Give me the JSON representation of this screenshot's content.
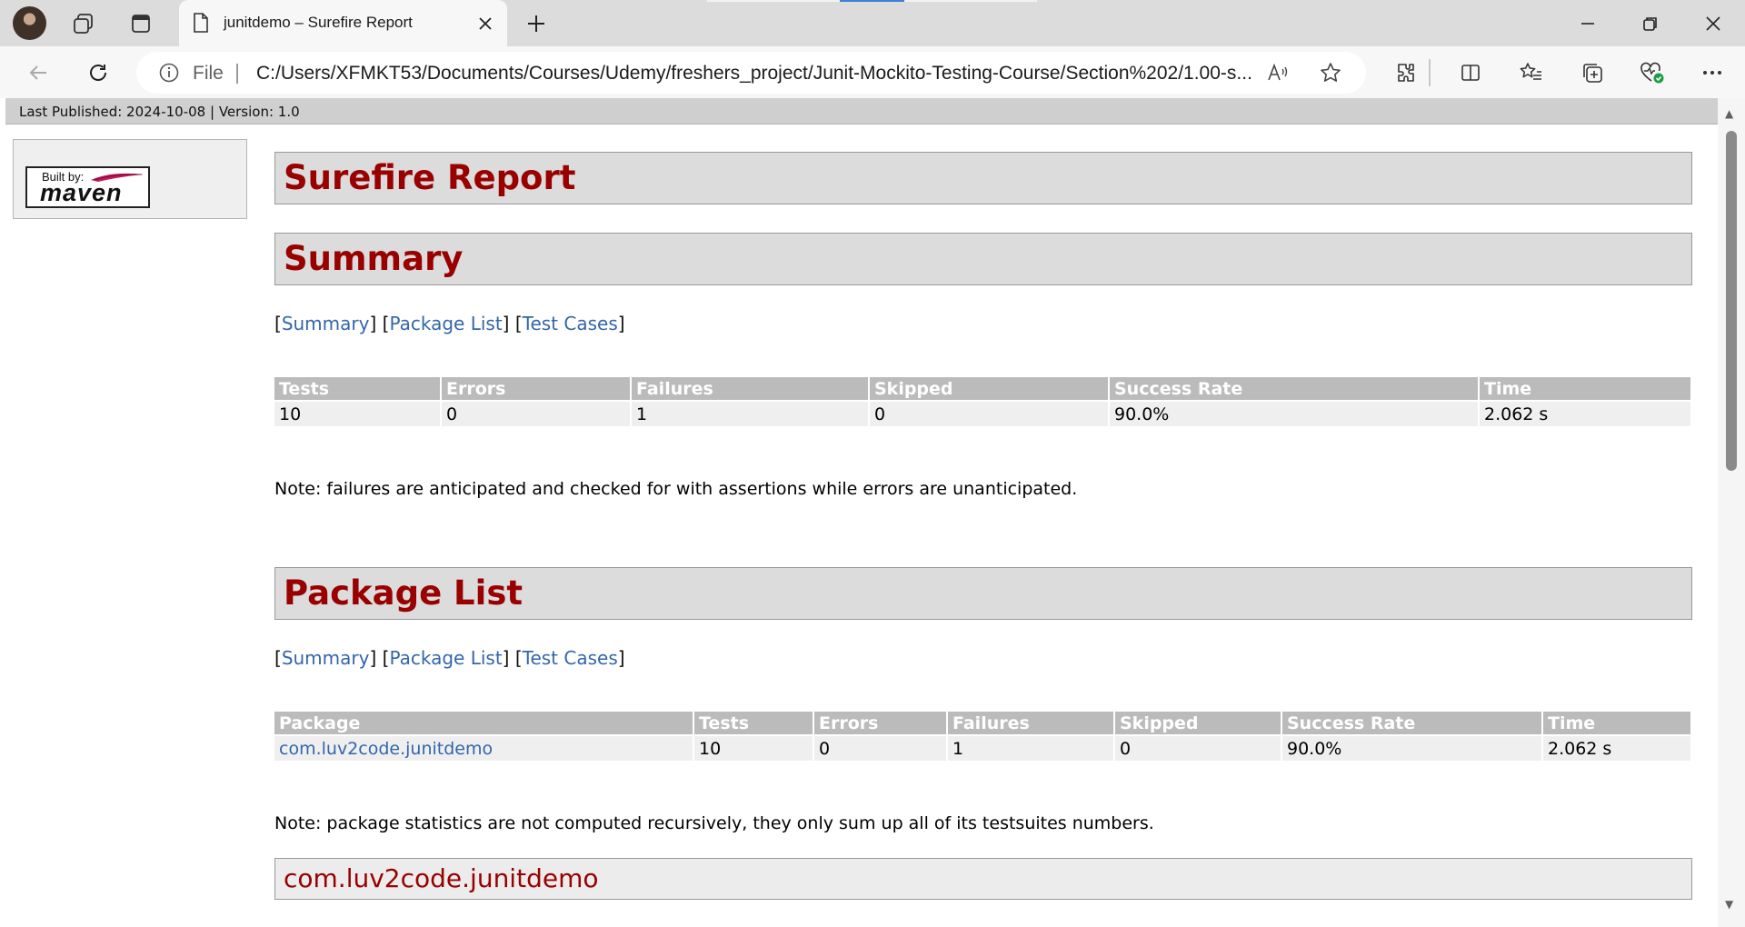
{
  "browser": {
    "tab_title": "junitdemo – Surefire Report",
    "address_prefix": "File",
    "address_url": "C:/Users/XFMKT53/Documents/Courses/Udemy/freshers_project/Junit-Mockito-Testing-Course/Section%202/1.00-s..."
  },
  "page": {
    "banner": "Last Published: 2024-10-08 | Version: 1.0",
    "logo_built_by": "Built by:",
    "logo_name": "maven",
    "title": "Surefire Report",
    "summary_heading": "Summary",
    "nav_links": [
      "Summary",
      "Package List",
      "Test Cases"
    ],
    "summary_table": {
      "headers": [
        "Tests",
        "Errors",
        "Failures",
        "Skipped",
        "Success Rate",
        "Time"
      ],
      "row": [
        "10",
        "0",
        "1",
        "0",
        "90.0%",
        "2.062 s"
      ]
    },
    "summary_note": "Note: failures are anticipated and checked for with assertions while errors are unanticipated.",
    "package_heading": "Package List",
    "package_table": {
      "headers": [
        "Package",
        "Tests",
        "Errors",
        "Failures",
        "Skipped",
        "Success Rate",
        "Time"
      ],
      "row": [
        "com.luv2code.junitdemo",
        "10",
        "0",
        "1",
        "0",
        "90.0%",
        "2.062 s"
      ]
    },
    "package_note": "Note: package statistics are not computed recursively, they only sum up all of its testsuites numbers.",
    "package_section": "com.luv2code.junitdemo"
  }
}
